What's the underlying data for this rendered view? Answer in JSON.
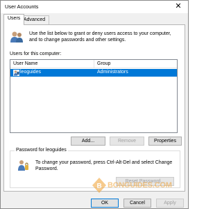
{
  "window": {
    "title": "User Accounts",
    "close_glyph": "✕"
  },
  "tabs": [
    {
      "label": "Users",
      "active": true
    },
    {
      "label": "Advanced",
      "active": false
    }
  ],
  "intro": {
    "text": "Use the list below to grant or deny users access to your computer, and to change passwords and other settings.",
    "icon": "users-icon"
  },
  "users_list": {
    "label": "Users for this computer:",
    "columns": [
      "User Name",
      "Group"
    ],
    "rows": [
      {
        "user": "leoguides",
        "group": "Administrators",
        "selected": true
      }
    ]
  },
  "list_buttons": {
    "add": "Add...",
    "remove": "Remove",
    "properties": "Properties"
  },
  "password": {
    "group_title": "Password for leoguides",
    "text": "To change your password, press Ctrl-Alt-Del and select Change Password.",
    "reset_button": "Reset Password...",
    "icon": "key-icon"
  },
  "footer_buttons": {
    "ok": "OK",
    "cancel": "Cancel",
    "apply": "Apply"
  },
  "watermark": {
    "text": "BONGUIDES.COM"
  },
  "colors": {
    "selection": "#0078d7",
    "watermark": "#f0a030"
  }
}
